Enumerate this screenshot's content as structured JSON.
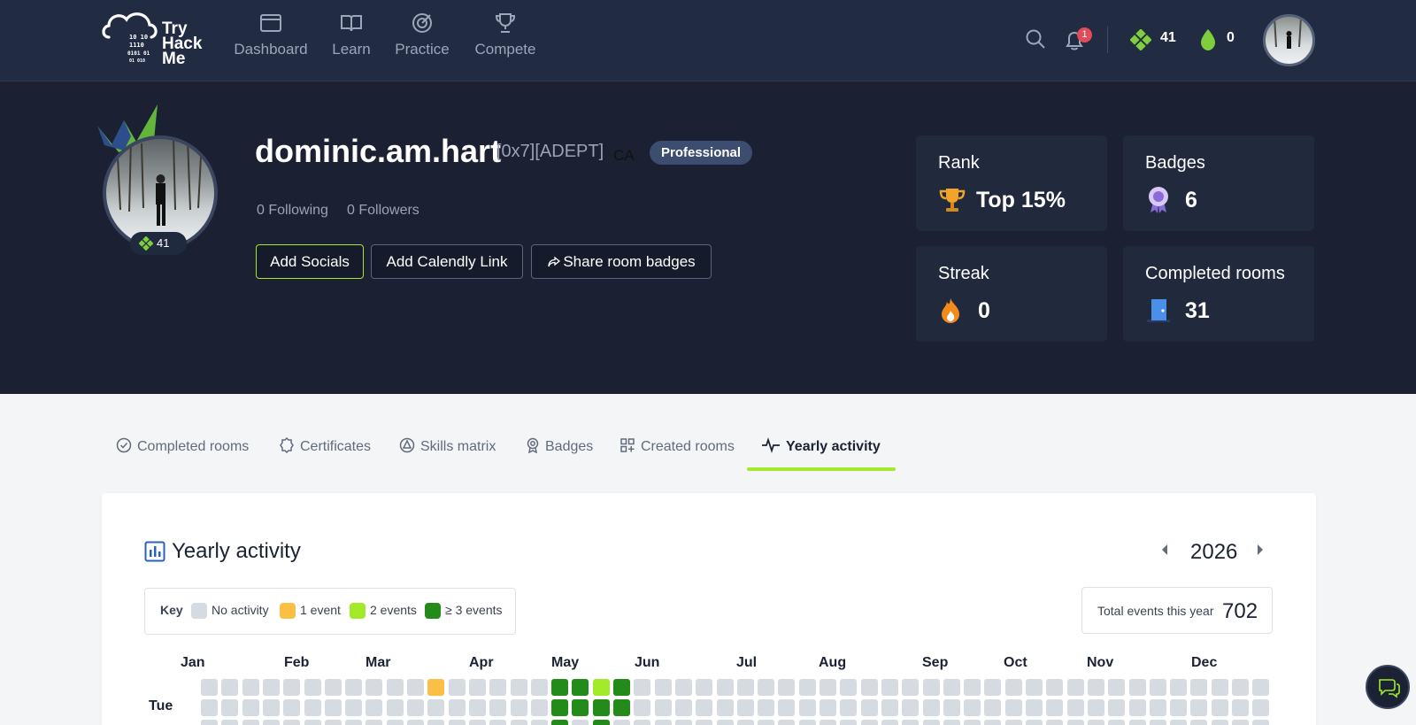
{
  "nav": {
    "logo_lines": [
      "Try",
      "Hack",
      "Me"
    ],
    "items": [
      {
        "label": "Dashboard",
        "icon": "window-icon"
      },
      {
        "label": "Learn",
        "icon": "book-icon"
      },
      {
        "label": "Practice",
        "icon": "target-icon"
      },
      {
        "label": "Compete",
        "icon": "trophy-icon"
      }
    ],
    "notifications_count": "1",
    "points": "41",
    "streak": "0"
  },
  "profile": {
    "username": "dominic.am.hart",
    "rank_tag": "[0x7][ADEPT]",
    "country": "CA",
    "plan": "Professional",
    "level_badge": "41",
    "following": "0 Following",
    "followers": "0 Followers",
    "buttons": {
      "add_socials": "Add Socials",
      "add_calendly": "Add Calendly Link",
      "share_badges": "Share room badges"
    }
  },
  "stats": {
    "rank_label": "Rank",
    "rank_value": "Top 15%",
    "badges_label": "Badges",
    "badges_value": "6",
    "streak_label": "Streak",
    "streak_value": "0",
    "completed_label": "Completed rooms",
    "completed_value": "31"
  },
  "tabs": [
    {
      "label": "Completed rooms",
      "icon": "check-circle-icon"
    },
    {
      "label": "Certificates",
      "icon": "certificate-icon"
    },
    {
      "label": "Skills matrix",
      "icon": "skills-icon"
    },
    {
      "label": "Badges",
      "icon": "badge-icon"
    },
    {
      "label": "Created rooms",
      "icon": "grid-plus-icon"
    },
    {
      "label": "Yearly activity",
      "icon": "pulse-icon",
      "active": true
    }
  ],
  "activity": {
    "title": "Yearly activity",
    "year": "2026",
    "key": {
      "label": "Key",
      "items": [
        {
          "label": "No activity",
          "color": "#d6dae1"
        },
        {
          "label": "1 event",
          "color": "#fbbf45"
        },
        {
          "label": "2 events",
          "color": "#a3ea2a"
        },
        {
          "label": "≥ 3 events",
          "color": "#238b1a"
        }
      ]
    },
    "total_label": "Total events this year",
    "total_value": "702",
    "months": [
      "Jan",
      "Feb",
      "Mar",
      "Apr",
      "May",
      "Jun",
      "Jul",
      "Aug",
      "Sep",
      "Oct",
      "Nov",
      "Dec"
    ],
    "day_label": "Tue",
    "week_count": 52,
    "active_cells": [
      {
        "week": 11,
        "day": 0,
        "level": 1
      },
      {
        "week": 17,
        "day": 0,
        "level": 3
      },
      {
        "week": 18,
        "day": 0,
        "level": 3
      },
      {
        "week": 19,
        "day": 0,
        "level": 2
      },
      {
        "week": 20,
        "day": 0,
        "level": 3
      },
      {
        "week": 17,
        "day": 1,
        "level": 3
      },
      {
        "week": 18,
        "day": 1,
        "level": 3
      },
      {
        "week": 19,
        "day": 1,
        "level": 3
      },
      {
        "week": 20,
        "day": 1,
        "level": 3
      },
      {
        "week": 17,
        "day": 2,
        "level": 3
      },
      {
        "week": 19,
        "day": 2,
        "level": 3
      }
    ]
  },
  "colors": {
    "accent_green": "#a3ea2a",
    "navy": "#1b2133",
    "nav_bg": "#212c42"
  }
}
